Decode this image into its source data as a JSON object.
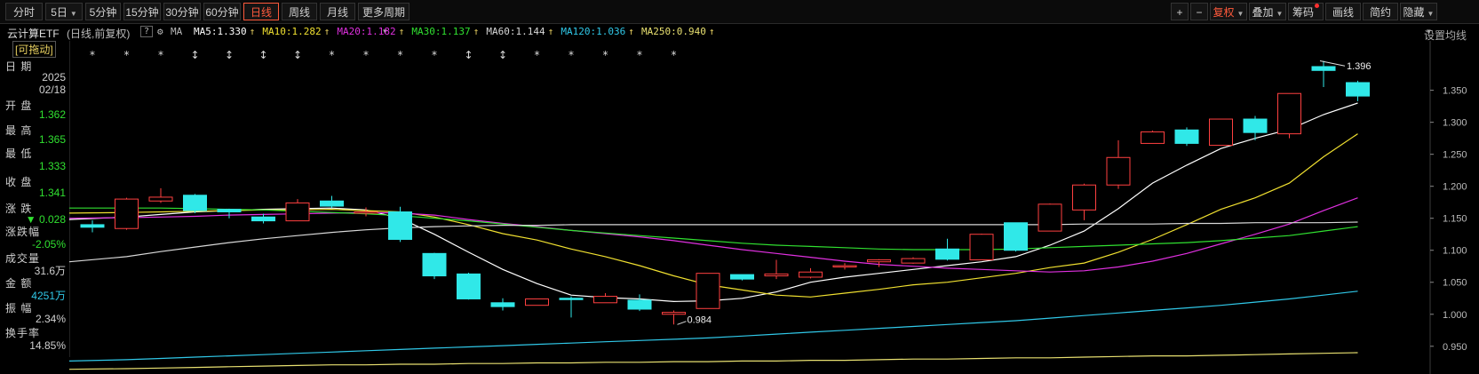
{
  "toolbar": {
    "periods": [
      {
        "label": "分时",
        "active": false
      },
      {
        "label": "5日",
        "active": false,
        "caret": true
      },
      {
        "label": "5分钟",
        "active": false
      },
      {
        "label": "15分钟",
        "active": false
      },
      {
        "label": "30分钟",
        "active": false
      },
      {
        "label": "60分钟",
        "active": false
      },
      {
        "label": "日线",
        "active": true
      },
      {
        "label": "周线",
        "active": false
      },
      {
        "label": "月线",
        "active": false
      },
      {
        "label": "更多周期",
        "active": false,
        "caret": true
      }
    ],
    "right": [
      {
        "label": "+"
      },
      {
        "label": "−"
      },
      {
        "label": "复权",
        "red": true,
        "caret": true
      },
      {
        "label": "叠加",
        "caret": true
      },
      {
        "label": "筹码",
        "dot": true
      },
      {
        "label": "画线"
      },
      {
        "label": "简约"
      },
      {
        "label": "隐藏",
        "caret": true
      }
    ]
  },
  "ma_bar": {
    "name": "云计算ETF",
    "mode": "(日线,前复权)",
    "help": "?",
    "ma_label": "MA",
    "items": [
      {
        "label": "MA5:1.330",
        "arrow": "↑",
        "color": "#ffffff"
      },
      {
        "label": "MA10:1.282",
        "arrow": "↑",
        "color": "#f0e030"
      },
      {
        "label": "MA20:1.182",
        "arrow": "↑",
        "color": "#e030e0"
      },
      {
        "label": "MA30:1.137",
        "arrow": "↑",
        "color": "#30e030"
      },
      {
        "label": "MA60:1.144",
        "arrow": "↑",
        "color": "#d8d8d8"
      },
      {
        "label": "MA120:1.036",
        "arrow": "↑",
        "color": "#30c8e8"
      },
      {
        "label": "MA250:0.940",
        "arrow": "↑",
        "color": "#e8e070"
      }
    ],
    "settings": "设置均线"
  },
  "info_panel": {
    "drag_label": "[可拖动]",
    "rows": [
      {
        "label": "日  期",
        "value": "2025",
        "color": "#d0d0d0"
      },
      {
        "label": "",
        "value": "02/18",
        "color": "#d0d0d0"
      },
      {
        "label": "开  盘",
        "value": "1.362",
        "color": "#30e030"
      },
      {
        "label": "最  高",
        "value": "1.365",
        "color": "#30e030"
      },
      {
        "label": "最  低",
        "value": "1.333",
        "color": "#30e030"
      },
      {
        "label": "收  盘",
        "value": "1.341",
        "color": "#30e030"
      },
      {
        "label": "涨  跌",
        "value": "▼ 0.028",
        "color": "#30e030"
      },
      {
        "label": "涨跌幅",
        "value": "-2.05%",
        "color": "#30e030"
      },
      {
        "label": "成交量",
        "value": "31.6万",
        "color": "#d0d0d0"
      },
      {
        "label": "金  额",
        "value": "4251万",
        "color": "#30c8e8"
      },
      {
        "label": "振  幅",
        "value": "2.34%",
        "color": "#d0d0d0"
      },
      {
        "label": "换手率",
        "value": "14.85%",
        "color": "#d0d0d0"
      }
    ]
  },
  "chart_data": {
    "type": "candlestick",
    "y_ticks": [
      "1.350",
      "1.300",
      "1.250",
      "1.200",
      "1.150",
      "1.100",
      "1.050",
      "1.000",
      "0.950"
    ],
    "y_tick_values": [
      1.35,
      1.3,
      1.25,
      1.2,
      1.15,
      1.1,
      1.05,
      1.0,
      0.95
    ],
    "ylim": [
      0.915,
      1.405
    ],
    "annotations": {
      "high": "1.396",
      "low": "0.984"
    },
    "markers": [
      "*",
      "*",
      "*",
      "↕",
      "↕",
      "↕",
      "↕",
      "*",
      "*",
      "*",
      "*",
      "↕",
      "↕",
      "*",
      "*",
      "*",
      "*",
      "*"
    ],
    "candles": [
      {
        "o": 1.14,
        "h": 1.147,
        "l": 1.128,
        "c": 1.136
      },
      {
        "o": 1.134,
        "h": 1.182,
        "l": 1.132,
        "c": 1.18
      },
      {
        "o": 1.177,
        "h": 1.197,
        "l": 1.174,
        "c": 1.183
      },
      {
        "o": 1.186,
        "h": 1.188,
        "l": 1.158,
        "c": 1.162
      },
      {
        "o": 1.164,
        "h": 1.165,
        "l": 1.15,
        "c": 1.16
      },
      {
        "o": 1.152,
        "h": 1.157,
        "l": 1.142,
        "c": 1.146
      },
      {
        "o": 1.146,
        "h": 1.18,
        "l": 1.146,
        "c": 1.174
      },
      {
        "o": 1.177,
        "h": 1.185,
        "l": 1.166,
        "c": 1.169
      },
      {
        "o": 1.16,
        "h": 1.167,
        "l": 1.153,
        "c": 1.16
      },
      {
        "o": 1.16,
        "h": 1.168,
        "l": 1.113,
        "c": 1.117
      },
      {
        "o": 1.095,
        "h": 1.096,
        "l": 1.055,
        "c": 1.06
      },
      {
        "o": 1.063,
        "h": 1.065,
        "l": 1.023,
        "c": 1.024
      },
      {
        "o": 1.018,
        "h": 1.025,
        "l": 1.006,
        "c": 1.012
      },
      {
        "o": 1.014,
        "h": 1.024,
        "l": 1.014,
        "c": 1.024
      },
      {
        "o": 1.025,
        "h": 1.028,
        "l": 0.995,
        "c": 1.024
      },
      {
        "o": 1.018,
        "h": 1.033,
        "l": 1.018,
        "c": 1.028
      },
      {
        "o": 1.022,
        "h": 1.031,
        "l": 1.005,
        "c": 1.008
      },
      {
        "o": 1.0,
        "h": 1.006,
        "l": 0.984,
        "c": 1.003
      },
      {
        "o": 1.009,
        "h": 1.064,
        "l": 1.009,
        "c": 1.064
      },
      {
        "o": 1.062,
        "h": 1.062,
        "l": 1.053,
        "c": 1.055
      },
      {
        "o": 1.06,
        "h": 1.085,
        "l": 1.055,
        "c": 1.063
      },
      {
        "o": 1.058,
        "h": 1.072,
        "l": 1.056,
        "c": 1.066
      },
      {
        "o": 1.076,
        "h": 1.08,
        "l": 1.07,
        "c": 1.076
      },
      {
        "o": 1.082,
        "h": 1.086,
        "l": 1.074,
        "c": 1.085
      },
      {
        "o": 1.08,
        "h": 1.089,
        "l": 1.079,
        "c": 1.087
      },
      {
        "o": 1.102,
        "h": 1.118,
        "l": 1.084,
        "c": 1.086
      },
      {
        "o": 1.085,
        "h": 1.126,
        "l": 1.085,
        "c": 1.125
      },
      {
        "o": 1.143,
        "h": 1.143,
        "l": 1.098,
        "c": 1.1
      },
      {
        "o": 1.13,
        "h": 1.173,
        "l": 1.13,
        "c": 1.172
      },
      {
        "o": 1.163,
        "h": 1.204,
        "l": 1.147,
        "c": 1.202
      },
      {
        "o": 1.202,
        "h": 1.272,
        "l": 1.196,
        "c": 1.245
      },
      {
        "o": 1.267,
        "h": 1.287,
        "l": 1.267,
        "c": 1.285
      },
      {
        "o": 1.288,
        "h": 1.292,
        "l": 1.263,
        "c": 1.267
      },
      {
        "o": 1.264,
        "h": 1.305,
        "l": 1.264,
        "c": 1.305
      },
      {
        "o": 1.305,
        "h": 1.31,
        "l": 1.272,
        "c": 1.284
      },
      {
        "o": 1.282,
        "h": 1.345,
        "l": 1.275,
        "c": 1.345
      },
      {
        "o": 1.387,
        "h": 1.396,
        "l": 1.355,
        "c": 1.381
      },
      {
        "o": 1.362,
        "h": 1.365,
        "l": 1.333,
        "c": 1.341
      }
    ],
    "ma_lines": [
      {
        "name": "MA5",
        "color": "#ffffff",
        "values": [
          1.148,
          1.152,
          1.156,
          1.16,
          1.162,
          1.164,
          1.165,
          1.166,
          1.163,
          1.15,
          1.125,
          1.097,
          1.07,
          1.048,
          1.03,
          1.026,
          1.024,
          1.02,
          1.021,
          1.025,
          1.035,
          1.05,
          1.058,
          1.064,
          1.07,
          1.076,
          1.082,
          1.09,
          1.108,
          1.13,
          1.165,
          1.205,
          1.233,
          1.259,
          1.275,
          1.289,
          1.312,
          1.33
        ]
      },
      {
        "name": "MA10",
        "color": "#f0e030",
        "values": [
          1.158,
          1.159,
          1.16,
          1.161,
          1.162,
          1.163,
          1.163,
          1.164,
          1.162,
          1.16,
          1.152,
          1.14,
          1.126,
          1.116,
          1.102,
          1.09,
          1.076,
          1.06,
          1.046,
          1.038,
          1.03,
          1.027,
          1.033,
          1.039,
          1.046,
          1.05,
          1.057,
          1.064,
          1.073,
          1.08,
          1.097,
          1.117,
          1.14,
          1.164,
          1.182,
          1.205,
          1.246,
          1.282
        ]
      },
      {
        "name": "MA20",
        "color": "#e030e0",
        "values": [
          1.15,
          1.151,
          1.152,
          1.153,
          1.155,
          1.156,
          1.157,
          1.158,
          1.159,
          1.158,
          1.155,
          1.148,
          1.142,
          1.137,
          1.131,
          1.126,
          1.121,
          1.115,
          1.108,
          1.101,
          1.095,
          1.089,
          1.083,
          1.078,
          1.075,
          1.072,
          1.07,
          1.068,
          1.066,
          1.068,
          1.074,
          1.083,
          1.095,
          1.11,
          1.125,
          1.141,
          1.162,
          1.182
        ]
      },
      {
        "name": "MA30",
        "color": "#30e030",
        "values": [
          1.166,
          1.166,
          1.166,
          1.165,
          1.164,
          1.163,
          1.161,
          1.159,
          1.157,
          1.154,
          1.15,
          1.146,
          1.141,
          1.136,
          1.131,
          1.127,
          1.123,
          1.119,
          1.115,
          1.111,
          1.108,
          1.106,
          1.104,
          1.102,
          1.101,
          1.101,
          1.101,
          1.102,
          1.104,
          1.106,
          1.108,
          1.11,
          1.112,
          1.115,
          1.119,
          1.123,
          1.13,
          1.137
        ]
      },
      {
        "name": "MA60",
        "color": "#d8d8d8",
        "values": [
          1.082,
          1.09,
          1.098,
          1.105,
          1.112,
          1.118,
          1.123,
          1.128,
          1.132,
          1.135,
          1.137,
          1.138,
          1.139,
          1.139,
          1.14,
          1.14,
          1.14,
          1.14,
          1.14,
          1.14,
          1.14,
          1.14,
          1.14,
          1.14,
          1.14,
          1.14,
          1.14,
          1.14,
          1.14,
          1.141,
          1.141,
          1.141,
          1.142,
          1.142,
          1.143,
          1.143,
          1.143,
          1.144
        ]
      },
      {
        "name": "MA120",
        "color": "#30c8e8",
        "values": [
          0.927,
          0.929,
          0.931,
          0.933,
          0.935,
          0.937,
          0.939,
          0.941,
          0.943,
          0.945,
          0.947,
          0.949,
          0.951,
          0.953,
          0.955,
          0.957,
          0.959,
          0.961,
          0.963,
          0.966,
          0.969,
          0.972,
          0.975,
          0.978,
          0.981,
          0.984,
          0.987,
          0.99,
          0.994,
          0.998,
          1.002,
          1.006,
          1.01,
          1.014,
          1.019,
          1.024,
          1.03,
          1.036
        ]
      },
      {
        "name": "MA250",
        "color": "#e8e070",
        "values": [
          0.914,
          0.915,
          0.916,
          0.917,
          0.918,
          0.919,
          0.92,
          0.921,
          0.921,
          0.922,
          0.922,
          0.923,
          0.923,
          0.924,
          0.924,
          0.925,
          0.925,
          0.926,
          0.926,
          0.927,
          0.927,
          0.928,
          0.928,
          0.929,
          0.93,
          0.93,
          0.931,
          0.932,
          0.932,
          0.933,
          0.934,
          0.935,
          0.935,
          0.936,
          0.937,
          0.938,
          0.939,
          0.94
        ]
      }
    ]
  }
}
